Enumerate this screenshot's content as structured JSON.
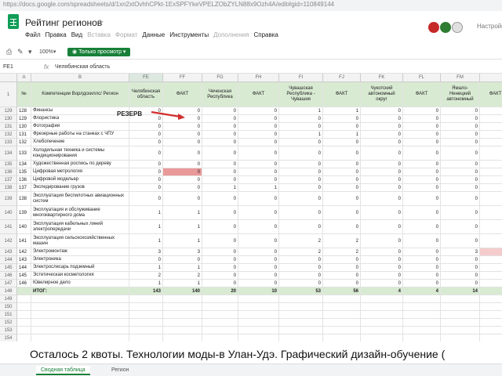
{
  "url": "https://docs.google.com/spreadsheets/d/1xn2xtOvhhCPkt-1ExSPFYkeVPELZObZYLN88x9Ozh4A/edit#gid=110849144",
  "title": "Рейтинг регионов",
  "menu": [
    "Файл",
    "Правка",
    "Вид",
    "Вставка",
    "Формат",
    "Данные",
    "Инструменты",
    "Дополнения",
    "Справка"
  ],
  "menu_dim": [
    false,
    false,
    false,
    true,
    true,
    false,
    false,
    true,
    false
  ],
  "settings_label": "Настройки",
  "toolbar": {
    "zoom": "100%",
    "view_button": "Только просмотр"
  },
  "formula_bar": {
    "cell_ref": "FE1",
    "value": "Челябинская область"
  },
  "columns": {
    "letters": [
      "A",
      "B",
      "FE",
      "FF",
      "FG",
      "FH",
      "FI",
      "FJ",
      "FK",
      "FL",
      "FM",
      ""
    ],
    "headers": [
      "№",
      "Компетенции Ворлдскиллс/ Регион",
      "Челябинская область",
      "ФАКТ",
      "Чеченская Республика",
      "ФАКТ",
      "Чувашская Республика - Чувашия",
      "ФАКТ",
      "Чукотский автономный округ",
      "ФАКТ",
      "Ямало-Ненецкий автономный",
      "ФАКТ"
    ]
  },
  "rows": [
    {
      "rn": "129",
      "no": "128",
      "name": "Финансы",
      "vals": [
        "0",
        "0",
        "0",
        "0",
        "1",
        "1",
        "0",
        "0",
        "0",
        ""
      ]
    },
    {
      "rn": "130",
      "no": "129",
      "name": "Флористика",
      "vals": [
        "0",
        "0",
        "0",
        "0",
        "0",
        "0",
        "0",
        "0",
        "0",
        ""
      ]
    },
    {
      "rn": "131",
      "no": "130",
      "name": "Фотография",
      "vals": [
        "0",
        "0",
        "0",
        "0",
        "0",
        "0",
        "0",
        "0",
        "0",
        ""
      ]
    },
    {
      "rn": "132",
      "no": "131",
      "name": "Фрезерные работы на станках с ЧПУ",
      "vals": [
        "0",
        "0",
        "0",
        "0",
        "1",
        "1",
        "0",
        "0",
        "0",
        ""
      ]
    },
    {
      "rn": "133",
      "no": "132",
      "name": "Хлебопечение",
      "vals": [
        "0",
        "0",
        "0",
        "0",
        "0",
        "0",
        "0",
        "0",
        "0",
        ""
      ]
    },
    {
      "rn": "134",
      "no": "133",
      "name": "Холодильная техника и системы кондиционирования",
      "vals": [
        "0",
        "0",
        "0",
        "0",
        "0",
        "0",
        "0",
        "0",
        "0",
        ""
      ]
    },
    {
      "rn": "135",
      "no": "134",
      "name": "Художественная роспись по дереву",
      "vals": [
        "0",
        "0",
        "0",
        "0",
        "0",
        "0",
        "0",
        "0",
        "0",
        ""
      ]
    },
    {
      "rn": "136",
      "no": "135",
      "name": "Цифровая метрология",
      "vals": [
        "0",
        "0",
        "0",
        "0",
        "0",
        "0",
        "0",
        "0",
        "0",
        ""
      ]
    },
    {
      "rn": "137",
      "no": "136",
      "name": "Цифровой модельер",
      "vals": [
        "0",
        "0",
        "0",
        "0",
        "0",
        "0",
        "0",
        "0",
        "0",
        ""
      ]
    },
    {
      "rn": "138",
      "no": "137",
      "name": "Экспедирование грузов",
      "vals": [
        "0",
        "0",
        "1",
        "1",
        "0",
        "0",
        "0",
        "0",
        "0",
        ""
      ]
    },
    {
      "rn": "139",
      "no": "138",
      "name": "Эксплуатация беспилотных авиационных систем",
      "vals": [
        "0",
        "0",
        "0",
        "0",
        "0",
        "0",
        "0",
        "0",
        "0",
        ""
      ]
    },
    {
      "rn": "140",
      "no": "139",
      "name": "Эксплуатация и обслуживание многоквартирного дома",
      "vals": [
        "1",
        "1",
        "0",
        "0",
        "0",
        "0",
        "0",
        "0",
        "0",
        ""
      ]
    },
    {
      "rn": "141",
      "no": "140",
      "name": "Эксплуатация кабельных линий электропередачи",
      "vals": [
        "1",
        "1",
        "0",
        "0",
        "0",
        "0",
        "0",
        "0",
        "0",
        ""
      ]
    },
    {
      "rn": "142",
      "no": "141",
      "name": "Эксплуатация сельскохозяйственных машин",
      "vals": [
        "1",
        "1",
        "0",
        "0",
        "2",
        "2",
        "0",
        "0",
        "0",
        ""
      ]
    },
    {
      "rn": "143",
      "no": "142",
      "name": "Электромонтаж",
      "vals": [
        "3",
        "3",
        "0",
        "0",
        "2",
        "2",
        "0",
        "0",
        "3",
        ""
      ]
    },
    {
      "rn": "144",
      "no": "143",
      "name": "Электроника",
      "vals": [
        "0",
        "0",
        "0",
        "0",
        "0",
        "0",
        "0",
        "0",
        "0",
        ""
      ]
    },
    {
      "rn": "145",
      "no": "144",
      "name": "Электрослесарь подземный",
      "vals": [
        "1",
        "1",
        "0",
        "0",
        "0",
        "0",
        "0",
        "0",
        "0",
        ""
      ]
    },
    {
      "rn": "146",
      "no": "145",
      "name": "Эстетическая косметология",
      "vals": [
        "2",
        "2",
        "0",
        "0",
        "0",
        "0",
        "0",
        "0",
        "0",
        ""
      ]
    },
    {
      "rn": "147",
      "no": "146",
      "name": "Ювелирное дело",
      "vals": [
        "1",
        "1",
        "0",
        "0",
        "0",
        "0",
        "0",
        "0",
        "0",
        ""
      ]
    }
  ],
  "total": {
    "rn": "148",
    "label": "ИТОГ:",
    "vals": [
      "143",
      "140",
      "20",
      "10",
      "53",
      "56",
      "4",
      "4",
      "14",
      ""
    ]
  },
  "row_header_label": "1",
  "reserve_label": "РЕЗЕРВ",
  "caption": "Осталось 2 квоты. Технологии моды-в Улан-Удэ. Графический дизайн-обучение (",
  "tabs": [
    "Сводная таблица",
    "Регион"
  ],
  "colors": {
    "accent": "#188038",
    "header_fill": "#d9ead3",
    "red_fill": "#ea9999",
    "yellow_fill": "#f6b26b"
  }
}
